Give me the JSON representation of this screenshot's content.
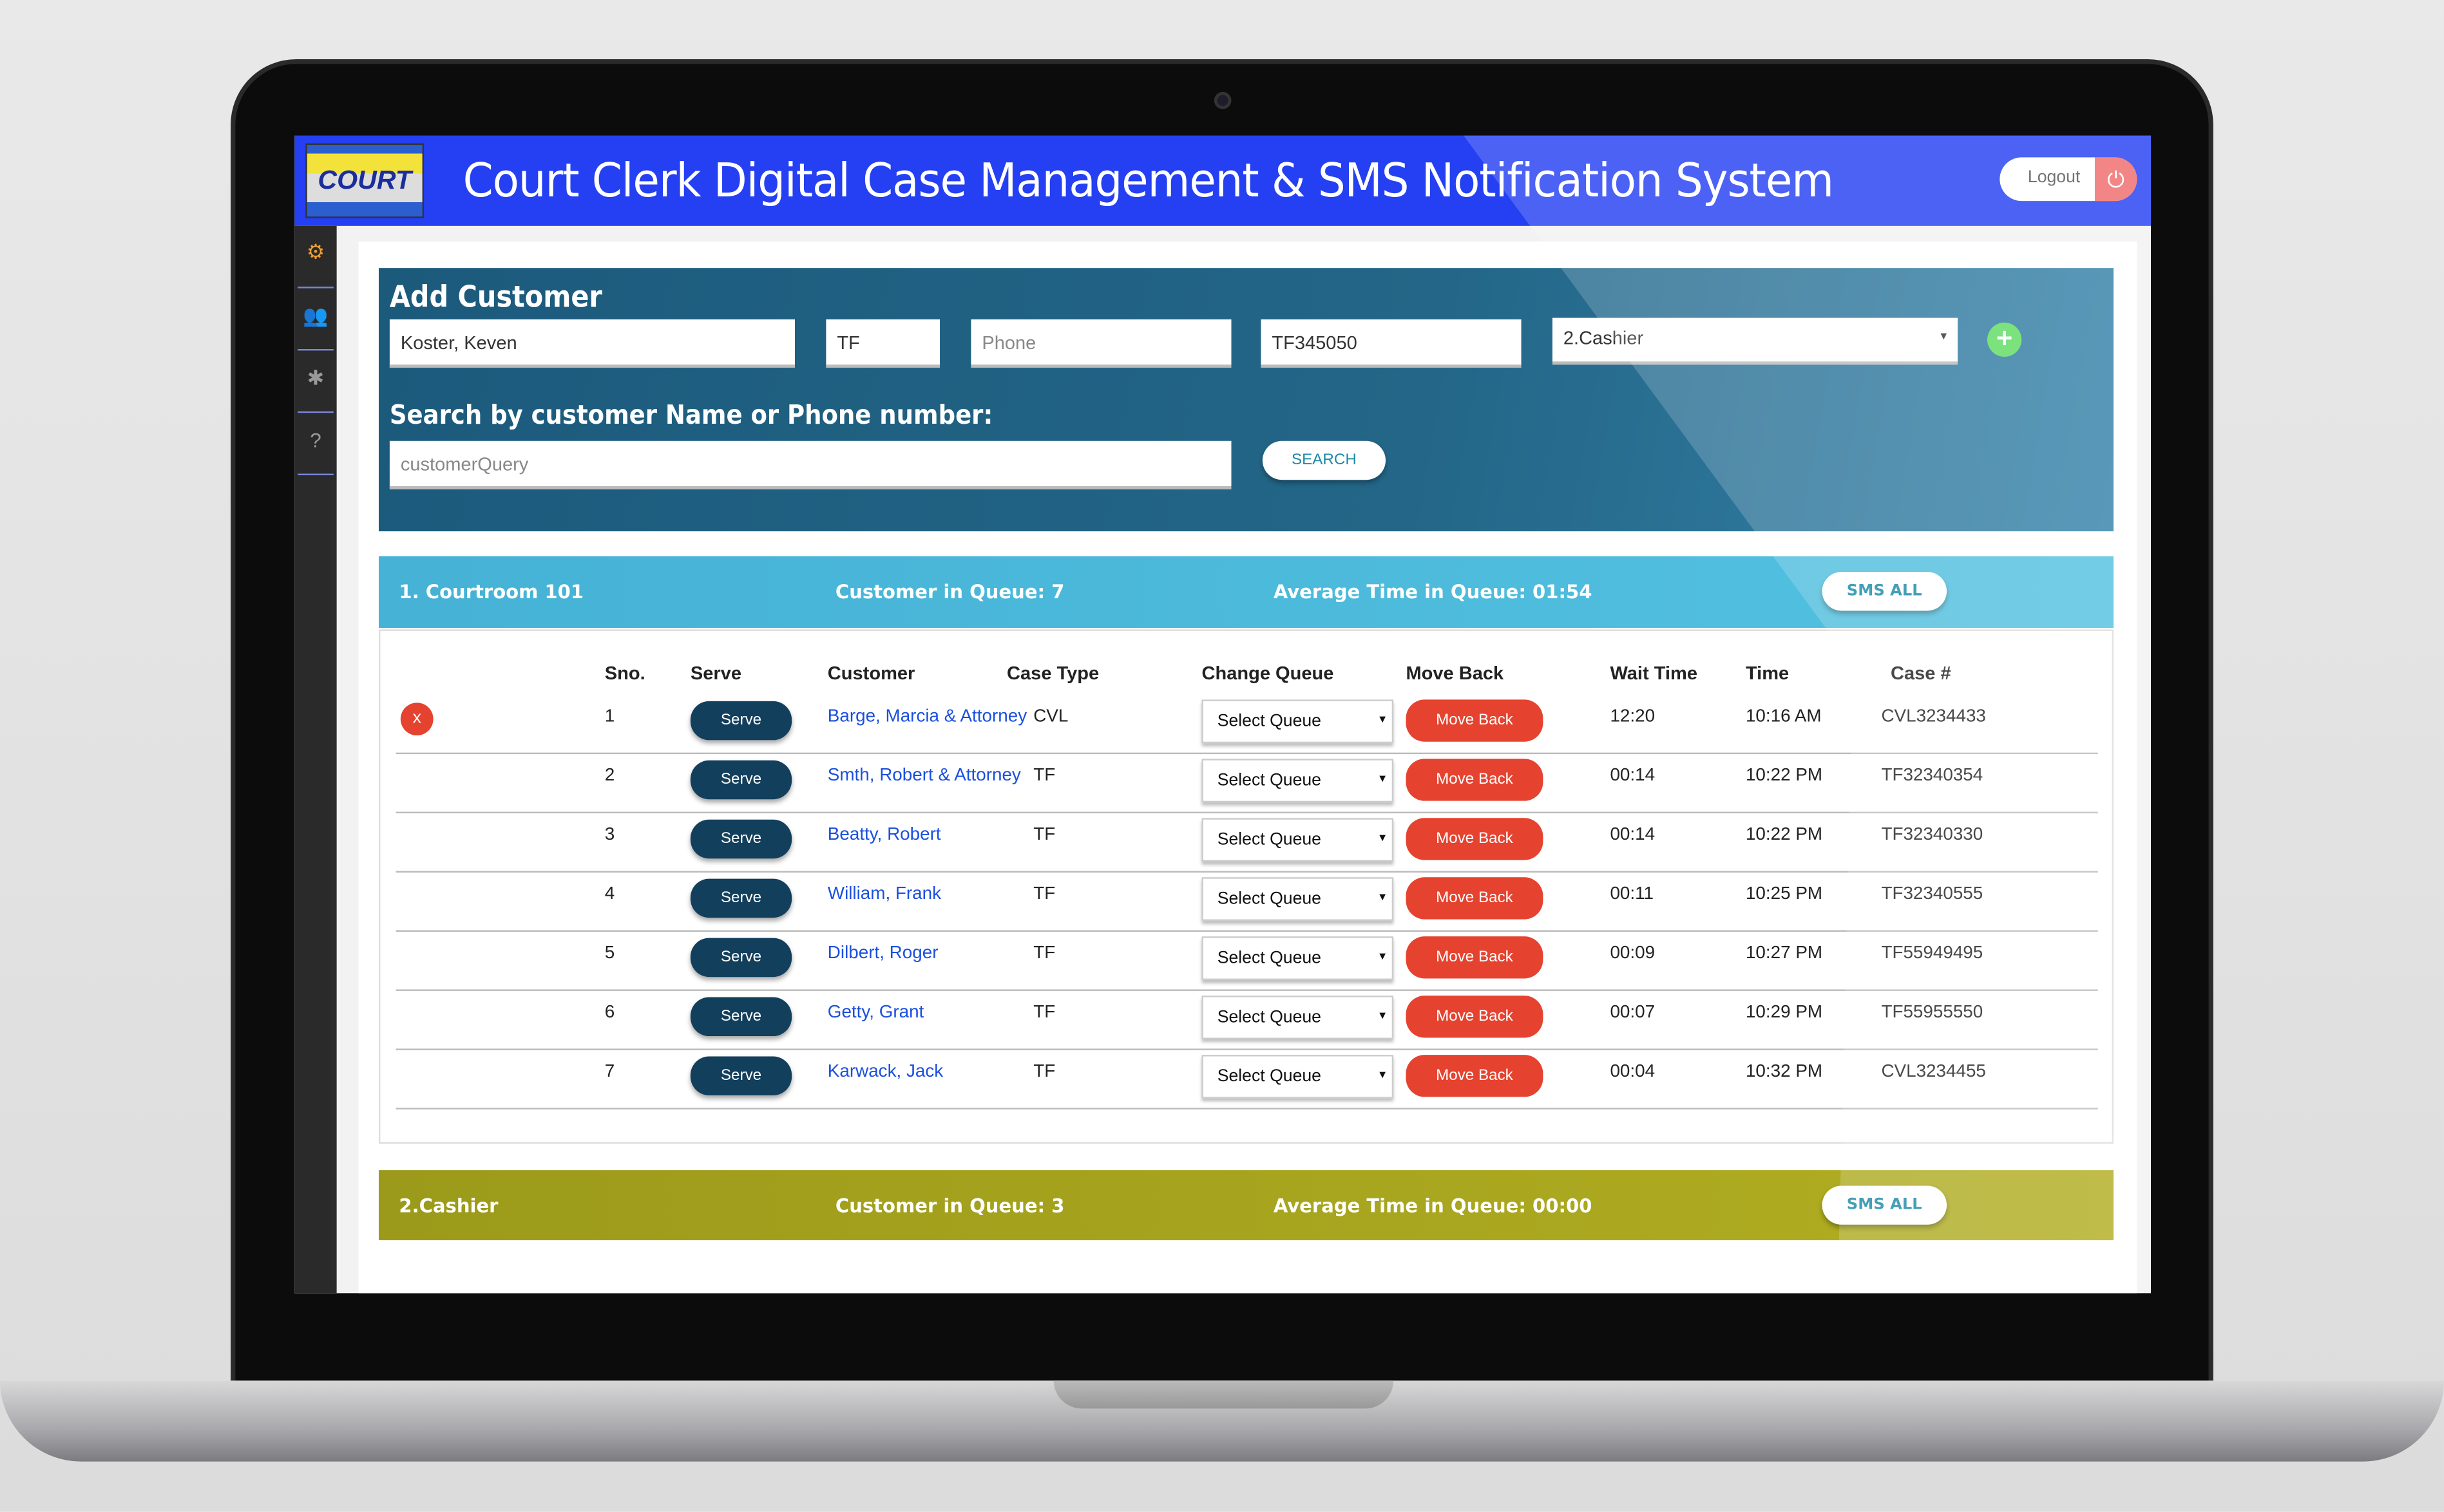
{
  "header": {
    "title": "Court Clerk Digital Case Management & SMS Notification System",
    "logo_text": "COURT",
    "logout_label": "Logout",
    "power_icon": "power-icon",
    "color": "#2440f2"
  },
  "sidebar": {
    "icons": [
      "gear-icon",
      "users-icon",
      "bug-icon",
      "help-icon"
    ]
  },
  "add_customer": {
    "title": "Add Customer",
    "name_value": "Koster, Keven",
    "case_type_value": "TF",
    "phone_placeholder": "Phone",
    "case_number_value": "TF345050",
    "queue_select_value": "2.Cashier",
    "add_icon": "plus-icon",
    "search_label": "Search by customer Name or Phone number:",
    "search_placeholder": "customerQuery",
    "search_button": "SEARCH"
  },
  "queues": [
    {
      "name": "1. Courtroom 101",
      "count_label": "Customer in Queue: 7",
      "avg_label": "Average Time in Queue: 01:54",
      "sms_label": "SMS ALL",
      "color": "#4bbcdc"
    },
    {
      "name": "2.Cashier",
      "count_label": "Customer in Queue: 3",
      "avg_label": "Average Time in Queue: 00:00",
      "sms_label": "SMS ALL",
      "color": "#a5a21e"
    }
  ],
  "table": {
    "headers": {
      "sno": "Sno.",
      "serve": "Serve",
      "customer": "Customer",
      "case_type": "Case Type",
      "change_queue": "Change Queue",
      "move_back": "Move Back",
      "wait_time": "Wait Time",
      "time": "Time",
      "case_no": "Case #"
    },
    "serve_label": "Serve",
    "select_label": "Select Queue",
    "move_back_label": "Move Back",
    "delete_label": "x",
    "rows": [
      {
        "sno": "1",
        "customer": "Barge, Marcia & Attorney",
        "case_type": "CVL",
        "wait": "12:20",
        "time": "10:16 AM",
        "case_no": "CVL3234433"
      },
      {
        "sno": "2",
        "customer": "Smth, Robert & Attorney",
        "case_type": "TF",
        "wait": "00:14",
        "time": "10:22 PM",
        "case_no": "TF32340354"
      },
      {
        "sno": "3",
        "customer": "Beatty, Robert",
        "case_type": "TF",
        "wait": "00:14",
        "time": "10:22 PM",
        "case_no": "TF32340330"
      },
      {
        "sno": "4",
        "customer": "William, Frank",
        "case_type": "TF",
        "wait": "00:11",
        "time": "10:25 PM",
        "case_no": "TF32340555"
      },
      {
        "sno": "5",
        "customer": "Dilbert, Roger",
        "case_type": "TF",
        "wait": "00:09",
        "time": "10:27 PM",
        "case_no": "TF55949495"
      },
      {
        "sno": "6",
        "customer": "Getty, Grant",
        "case_type": "TF",
        "wait": "00:07",
        "time": "10:29 PM",
        "case_no": "TF55955550"
      },
      {
        "sno": "7",
        "customer": "Karwack, Jack",
        "case_type": "TF",
        "wait": "00:04",
        "time": "10:32 PM",
        "case_no": "CVL3234455"
      }
    ]
  }
}
